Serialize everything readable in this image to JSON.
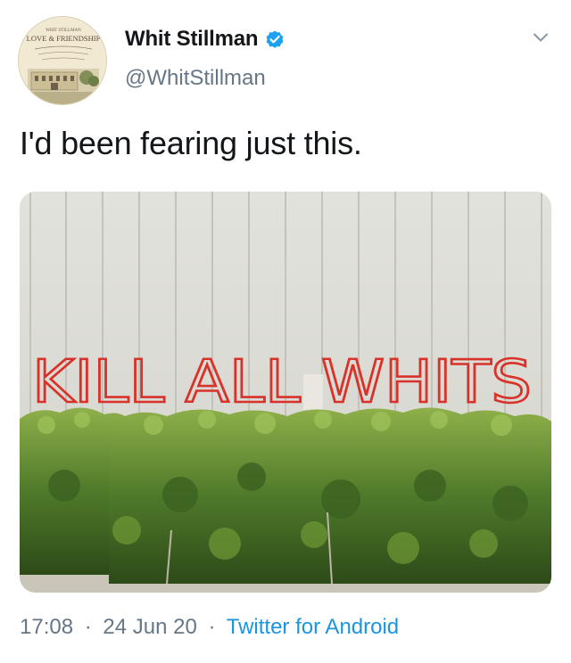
{
  "tweet": {
    "display_name": "Whit Stillman",
    "handle": "@WhitStillman",
    "verified": true,
    "text": "I'd been fearing just this.",
    "time": "17:08",
    "date": "24 Jun 20",
    "separator": "·",
    "source": "Twitter for Android",
    "avatar": {
      "top_text": "WHIT STILLMAN",
      "title_text": "LOVE & FRIENDSHIP"
    },
    "image": {
      "graffiti_text": "KILL ALL WHITS"
    },
    "icons": {
      "verified": "verified-badge-icon",
      "caret": "chevron-down-icon"
    },
    "colors": {
      "name": "#14171a",
      "secondary": "#657786",
      "link": "#1b95e0",
      "verified": "#1da1f2",
      "graffiti": "#d9322b"
    }
  }
}
